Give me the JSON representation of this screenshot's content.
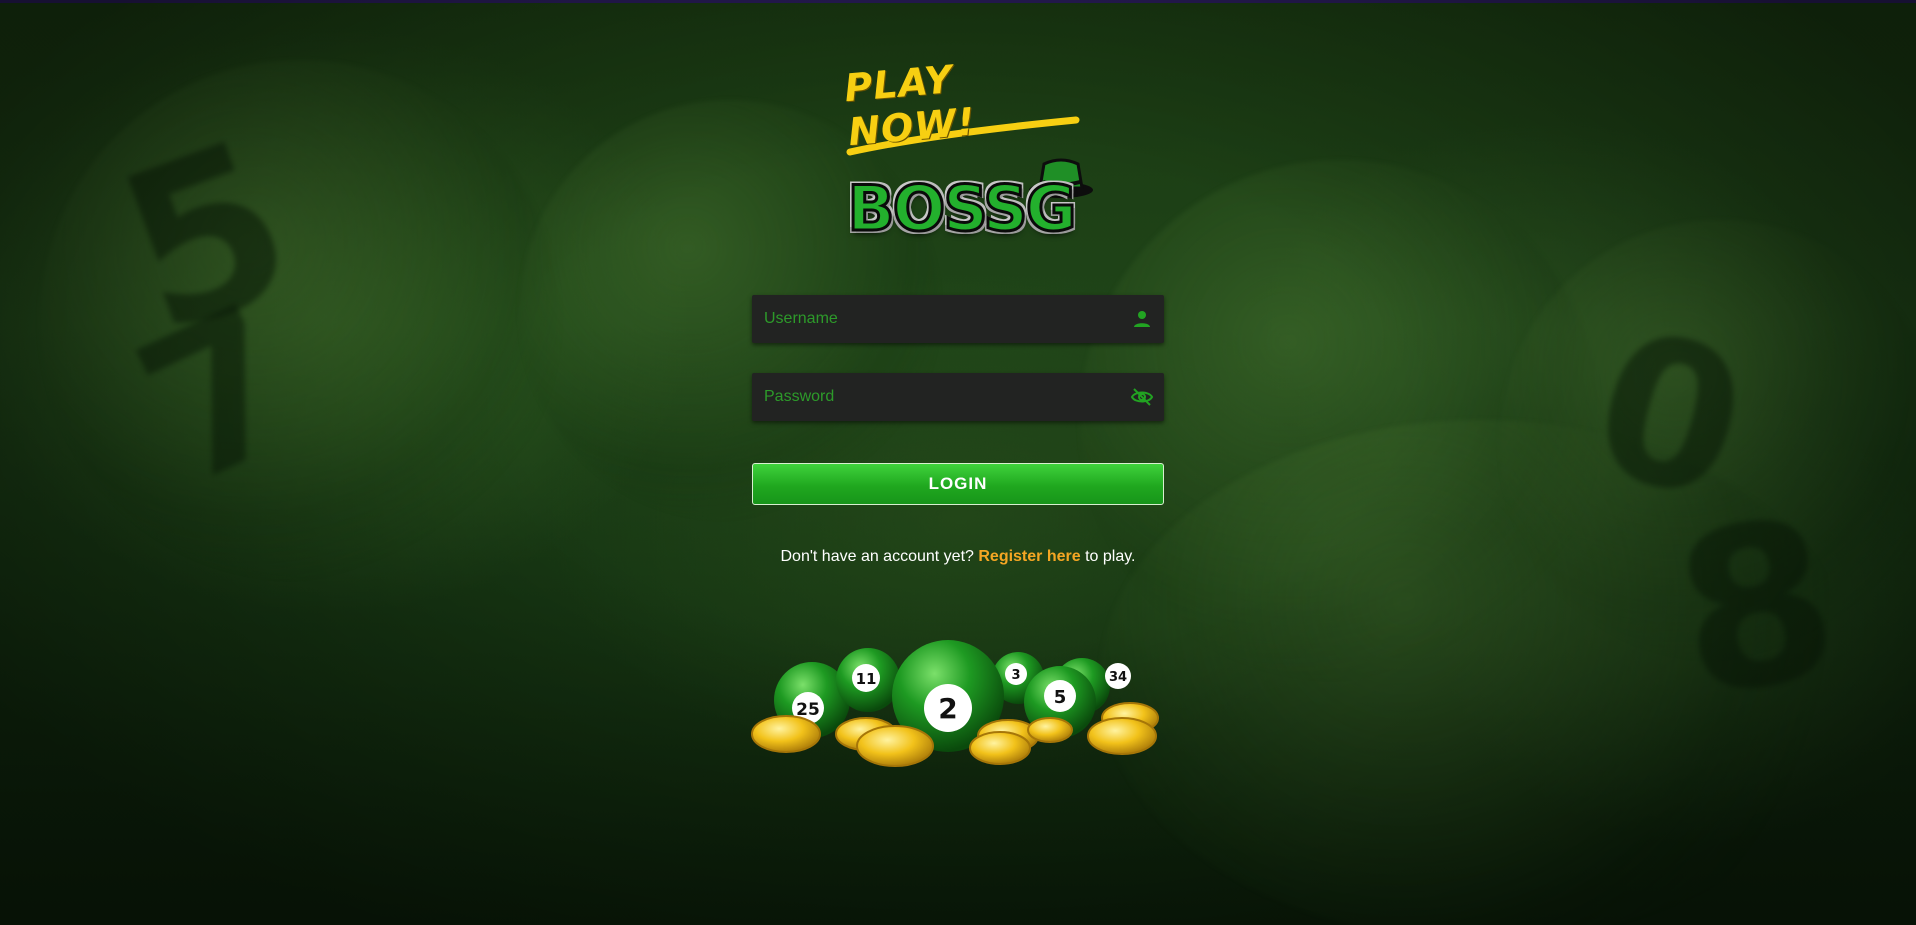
{
  "header": {
    "play_now_text": "PLAY NOW!",
    "logo_text": "BOSSG"
  },
  "form": {
    "username_placeholder": "Username",
    "password_placeholder": "Password",
    "login_label": "LOGIN",
    "username_icon": "user-icon",
    "password_icon": "eye-off-icon"
  },
  "register": {
    "prefix": "Don't have an account yet?",
    "link_text": "Register here",
    "suffix": "to play."
  },
  "decoration": {
    "ball_numbers": [
      "25",
      "11",
      "2",
      "3",
      "5",
      "34"
    ]
  },
  "colors": {
    "accent_green": "#23b02d",
    "link_orange": "#f5a623",
    "play_now_yellow": "#f7cf12",
    "field_bg": "#222322"
  }
}
